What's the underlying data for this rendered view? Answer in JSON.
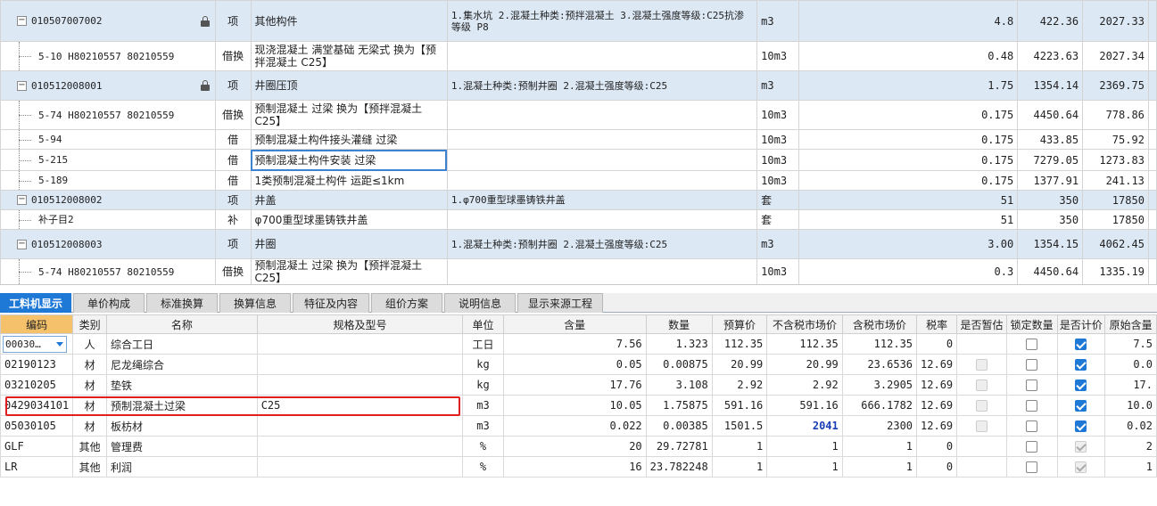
{
  "top_rows": [
    {
      "kind": "item",
      "code": "010507007002",
      "locked": true,
      "type": "项",
      "name": "其他构件",
      "features": "1.集水坑\n2.混凝土种类:预拌混凝土\n3.混凝土强度等级:C25抗渗等级 P8",
      "unit": "m3",
      "qty": "4.8",
      "price": "422.36",
      "total": "2027.33"
    },
    {
      "kind": "sub",
      "code": "5-10 H80210557 80210559",
      "type": "借换",
      "name": "现浇混凝土 满堂基础 无梁式  换为【预拌混凝土 C25】",
      "features": "",
      "unit": "10m3",
      "qty": "0.48",
      "price": "4223.63",
      "total": "2027.34"
    },
    {
      "kind": "item",
      "code": "010512008001",
      "locked": true,
      "type": "项",
      "name": "井圈压顶",
      "features": "1.混凝土种类:预制井圈\n2.混凝土强度等级:C25",
      "unit": "m3",
      "qty": "1.75",
      "price": "1354.14",
      "total": "2369.75"
    },
    {
      "kind": "sub",
      "code": "5-74 H80210557 80210559",
      "type": "借换",
      "name": "预制混凝土 过梁  换为【预拌混凝土 C25】",
      "features": "",
      "unit": "10m3",
      "qty": "0.175",
      "price": "4450.64",
      "total": "778.86"
    },
    {
      "kind": "sub",
      "code": "5-94",
      "type": "借",
      "name": "预制混凝土构件接头灌缝 过梁",
      "features": "",
      "unit": "10m3",
      "qty": "0.175",
      "price": "433.85",
      "total": "75.92"
    },
    {
      "kind": "sub",
      "code": "5-215",
      "type": "借",
      "name": "预制混凝土构件安装 过梁",
      "features": "",
      "unit": "10m3",
      "qty": "0.175",
      "price": "7279.05",
      "total": "1273.83",
      "selected": true
    },
    {
      "kind": "sub",
      "code": "5-189",
      "type": "借",
      "name": "1类预制混凝土构件 运距≤1km",
      "features": "",
      "unit": "10m3",
      "qty": "0.175",
      "price": "1377.91",
      "total": "241.13"
    },
    {
      "kind": "item",
      "code": "010512008002",
      "locked": false,
      "type": "项",
      "name": "井盖",
      "features": "1.φ700重型球墨铸铁井盖",
      "unit": "套",
      "qty": "51",
      "price": "350",
      "total": "17850"
    },
    {
      "kind": "sub",
      "code": "补子目2",
      "type": "补",
      "name": "φ700重型球墨铸铁井盖",
      "features": "",
      "unit": "套",
      "qty": "51",
      "price": "350",
      "total": "17850"
    },
    {
      "kind": "item",
      "code": "010512008003",
      "locked": false,
      "type": "项",
      "name": "井圈",
      "features": "1.混凝土种类:预制井圈\n2.混凝土强度等级:C25",
      "unit": "m3",
      "qty": "3.00",
      "price": "1354.15",
      "total": "4062.45"
    },
    {
      "kind": "sub",
      "code": "5-74 H80210557 80210559",
      "type": "借换",
      "name": "预制混凝土 过梁  换为【预拌混凝土 C25】",
      "features": "",
      "unit": "10m3",
      "qty": "0.3",
      "price": "4450.64",
      "total": "1335.19"
    }
  ],
  "tabs": [
    "工料机显示",
    "单价构成",
    "标准换算",
    "换算信息",
    "特征及内容",
    "组价方案",
    "说明信息",
    "显示来源工程"
  ],
  "headers": [
    "编码",
    "类别",
    "名称",
    "规格及型号",
    "单位",
    "含量",
    "数量",
    "预算价",
    "不含税市场价",
    "含税市场价",
    "税率",
    "是否暂估",
    "锁定数量",
    "是否计价",
    "原始含量"
  ],
  "bottom_rows": [
    {
      "code": "00030…",
      "cat": "人",
      "name": "综合工日",
      "spec": "",
      "unit": "工日",
      "content": "7.56",
      "qty": "1.323",
      "budget": "112.35",
      "mkt_ex": "112.35",
      "mkt_in": "112.35",
      "tax": "0",
      "est": "none",
      "lock": "off",
      "priced": "on",
      "orig": "7.5"
    },
    {
      "code": "02190123",
      "cat": "材",
      "name": "尼龙绳综合",
      "spec": "",
      "unit": "kg",
      "content": "0.05",
      "qty": "0.00875",
      "budget": "20.99",
      "mkt_ex": "20.99",
      "mkt_in": "23.6536",
      "tax": "12.69",
      "est": "dis",
      "lock": "off",
      "priced": "on",
      "orig": "0.0"
    },
    {
      "code": "03210205",
      "cat": "材",
      "name": "垫铁",
      "spec": "",
      "unit": "kg",
      "content": "17.76",
      "qty": "3.108",
      "budget": "2.92",
      "mkt_ex": "2.92",
      "mkt_in": "3.2905",
      "tax": "12.69",
      "est": "dis",
      "lock": "off",
      "priced": "on",
      "orig": "17."
    },
    {
      "code": "0429034101",
      "cat": "材",
      "name": "预制混凝土过梁",
      "spec": "C25",
      "unit": "m3",
      "content": "10.05",
      "qty": "1.75875",
      "budget": "591.16",
      "mkt_ex": "591.16",
      "mkt_in": "666.1782",
      "tax": "12.69",
      "est": "dis",
      "lock": "off",
      "priced": "on",
      "orig": "10.0"
    },
    {
      "code": "05030105",
      "cat": "材",
      "name": "板枋材",
      "spec": "",
      "unit": "m3",
      "content": "0.022",
      "qty": "0.00385",
      "budget": "1501.5",
      "mkt_ex": "2041",
      "mkt_in": "2300",
      "tax": "12.69",
      "est": "dis",
      "lock": "off",
      "priced": "on",
      "orig": "0.02",
      "mkt_ex_highlight": true
    },
    {
      "code": "GLF",
      "cat": "其他",
      "name": "管理费",
      "spec": "",
      "unit": "%",
      "content": "20",
      "qty": "29.72781",
      "budget": "1",
      "mkt_ex": "1",
      "mkt_in": "1",
      "tax": "0",
      "est": "none",
      "lock": "off",
      "priced": "dis-on",
      "orig": "2"
    },
    {
      "code": "LR",
      "cat": "其他",
      "name": "利润",
      "spec": "",
      "unit": "%",
      "content": "16",
      "qty": "23.782248",
      "budget": "1",
      "mkt_ex": "1",
      "mkt_in": "1",
      "tax": "0",
      "est": "none",
      "lock": "off",
      "priced": "dis-on",
      "orig": "1"
    }
  ]
}
